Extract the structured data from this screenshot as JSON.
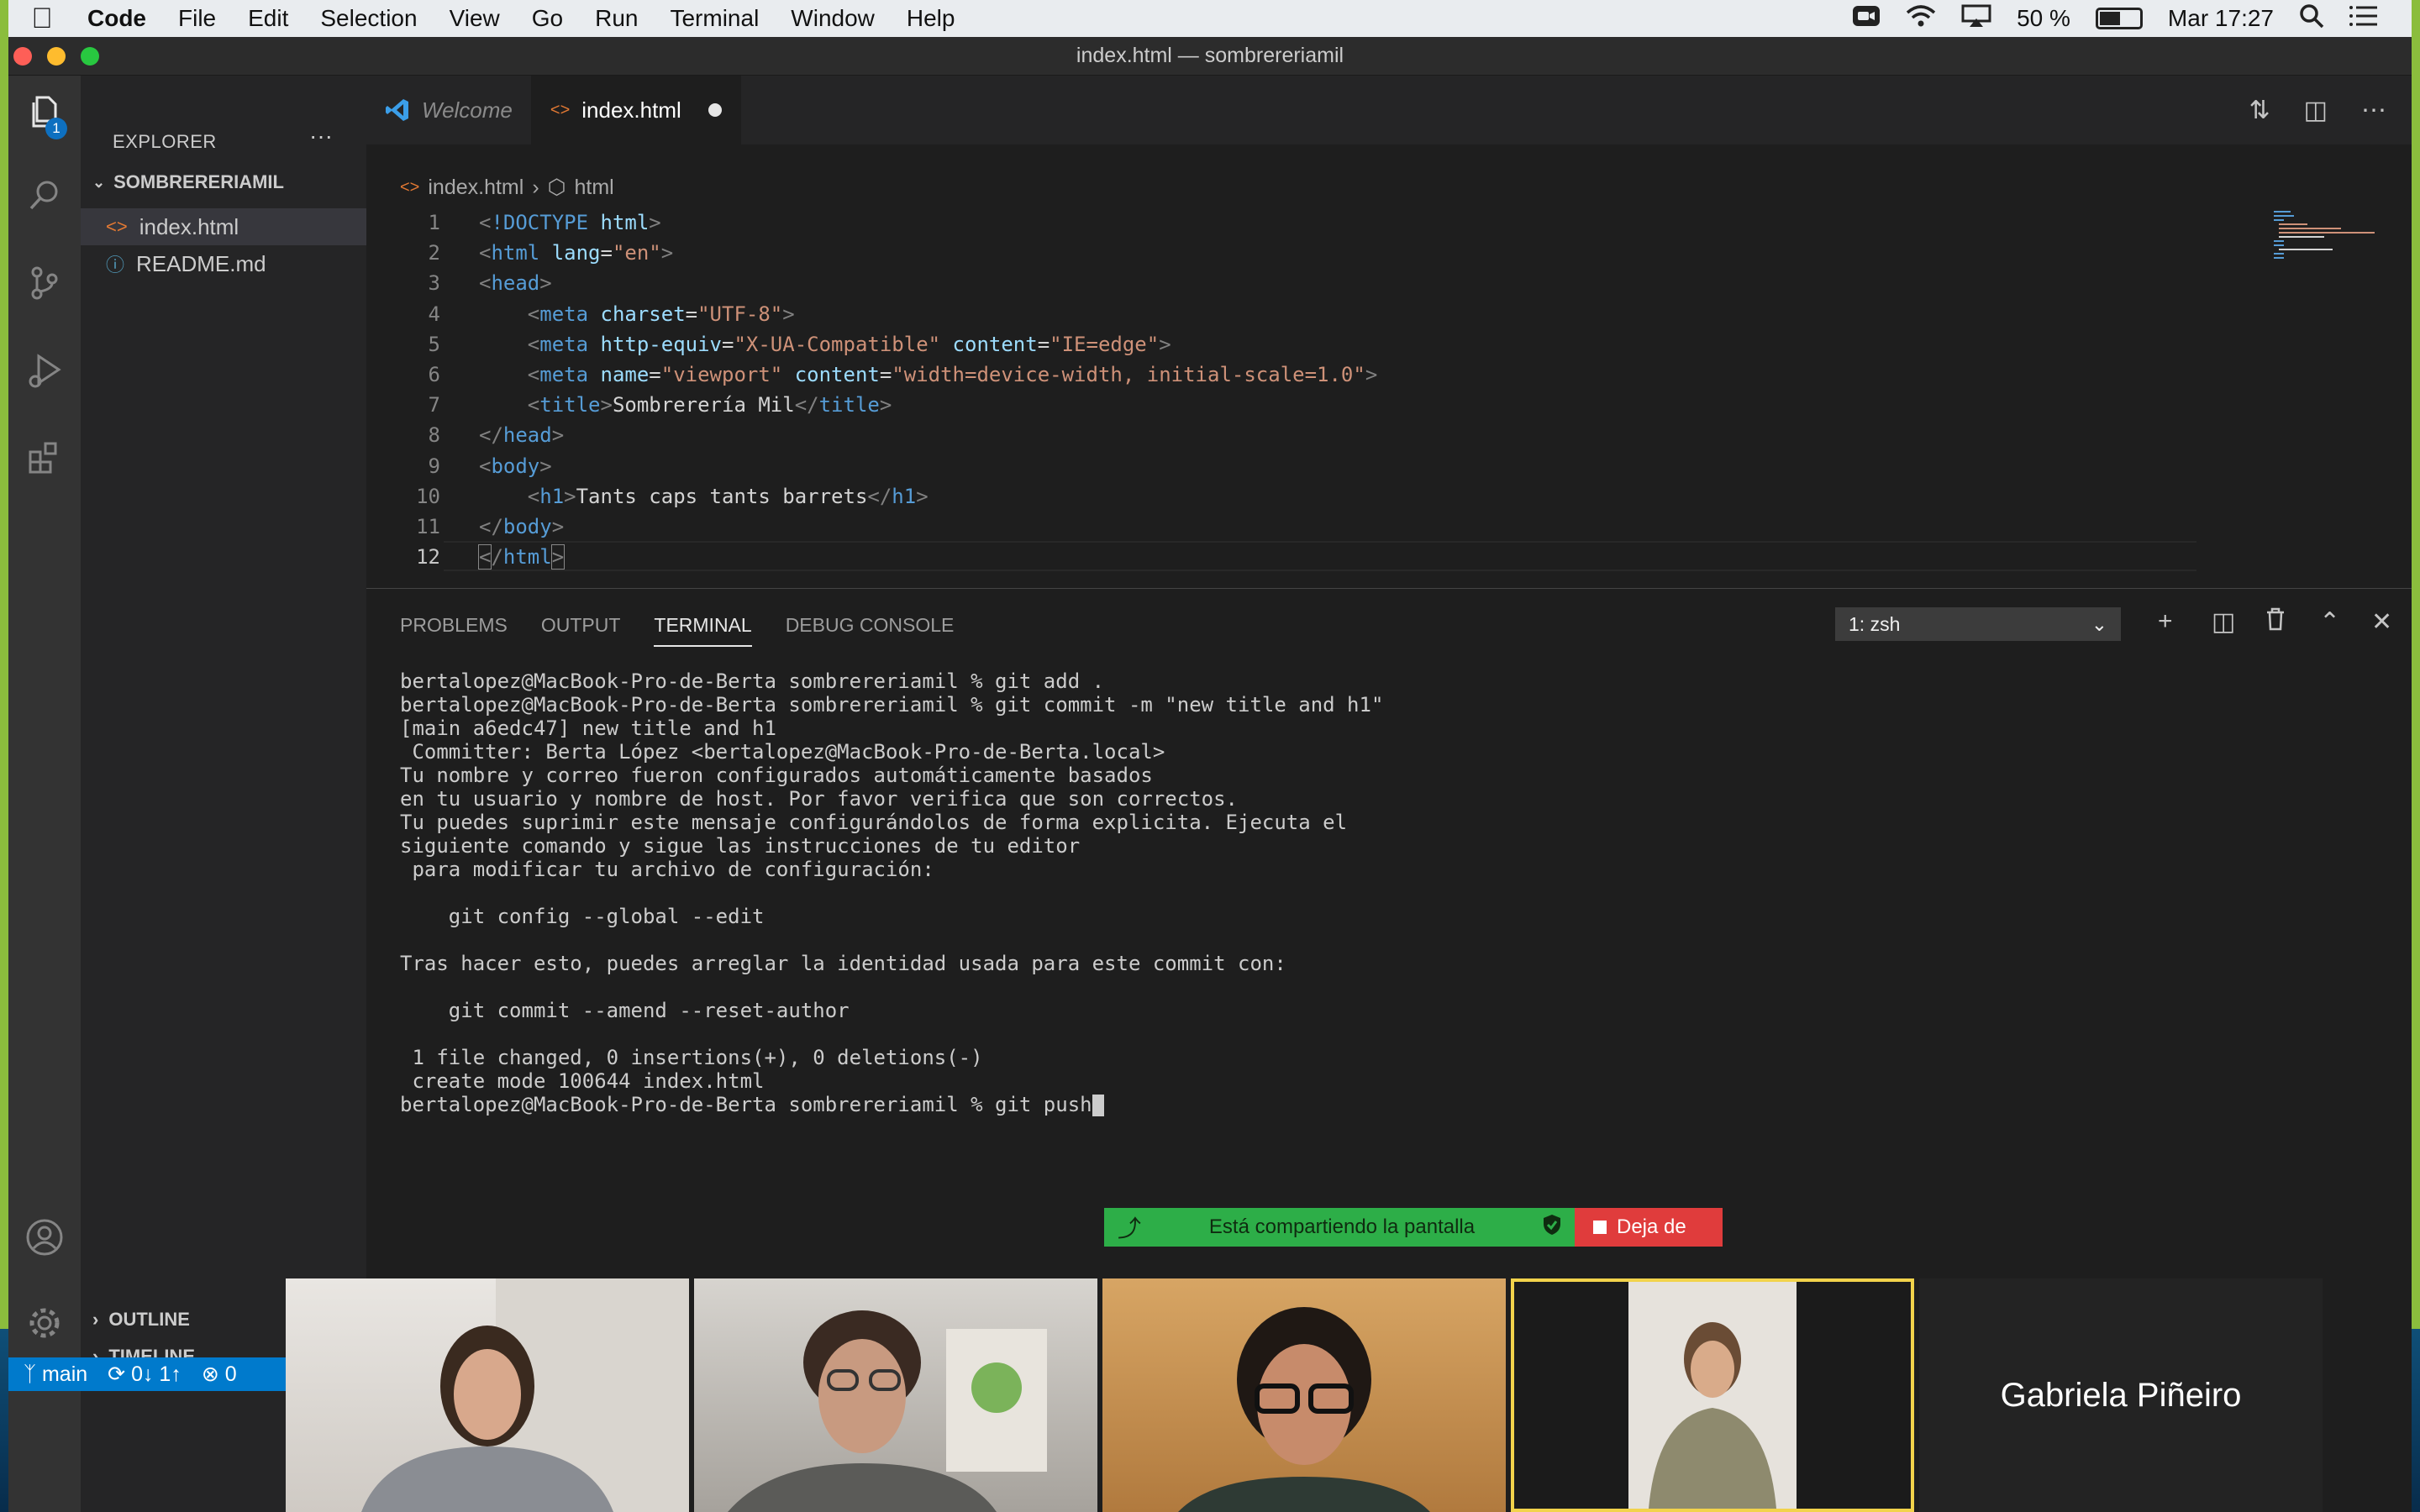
{
  "menubar": {
    "app": "Code",
    "items": [
      "File",
      "Edit",
      "Selection",
      "View",
      "Go",
      "Run",
      "Terminal",
      "Window",
      "Help"
    ],
    "battery": "50 %",
    "clock": "Mar 17:27"
  },
  "window": {
    "title": "index.html — sombrereriamil"
  },
  "activity": {
    "explorer_badge": "1"
  },
  "sidebar": {
    "title": "EXPLORER",
    "more": "···",
    "folder": "SOMBRERERIAMIL",
    "files": [
      "index.html",
      "README.md"
    ],
    "outline": "OUTLINE",
    "timeline": "TIMELINE"
  },
  "tabs": {
    "welcome": "Welcome",
    "index": "index.html"
  },
  "breadcrumb": {
    "file": "index.html",
    "symbol": "html"
  },
  "code": {
    "l1_doctype": "!DOCTYPE",
    "l1_html": "html",
    "l2_tag": "html",
    "l2_attr": "lang",
    "l2_val": "\"en\"",
    "head": "head",
    "meta": "meta",
    "charset": "charset",
    "charset_val": "\"UTF-8\"",
    "http_equiv": "http-equiv",
    "http_equiv_val": "\"X-UA-Compatible\"",
    "content": "content",
    "ie_edge": "\"IE=edge\"",
    "name": "name",
    "viewport": "\"viewport\"",
    "viewport_content": "\"width=device-width, initial-scale=1.0\"",
    "title_tag": "title",
    "title_text": "Sombrerería Mil",
    "body": "body",
    "h1": "h1",
    "h1_text": "Tants caps tants barrets"
  },
  "panel": {
    "tabs": [
      "PROBLEMS",
      "OUTPUT",
      "TERMINAL",
      "DEBUG CONSOLE"
    ],
    "shell": "1: zsh"
  },
  "terminal": {
    "lines": [
      "bertalopez@MacBook-Pro-de-Berta sombrereriamil % git add .",
      "bertalopez@MacBook-Pro-de-Berta sombrereriamil % git commit -m \"new title and h1\"",
      "[main a6edc47] new title and h1",
      " Committer: Berta López <bertalopez@MacBook-Pro-de-Berta.local>",
      "Tu nombre y correo fueron configurados automáticamente basados",
      "en tu usuario y nombre de host. Por favor verifica que son correctos.",
      "Tu puedes suprimir este mensaje configurándolos de forma explicita. Ejecuta el",
      "siguiente comando y sigue las instrucciones de tu editor",
      " para modificar tu archivo de configuración:",
      "",
      "    git config --global --edit",
      "",
      "Tras hacer esto, puedes arreglar la identidad usada para este commit con:",
      "",
      "    git commit --amend --reset-author",
      "",
      " 1 file changed, 0 insertions(+), 0 deletions(-)",
      " create mode 100644 index.html"
    ],
    "prompt": "bertalopez@MacBook-Pro-de-Berta sombrereriamil % git push"
  },
  "status": {
    "branch": "main",
    "sync": "0↓ 1↑",
    "errors": "0"
  },
  "zoom": {
    "sharing": "Está compartiendo la pantalla",
    "stop": "Deja de",
    "participant_name": "Gabriela Piñeiro"
  }
}
